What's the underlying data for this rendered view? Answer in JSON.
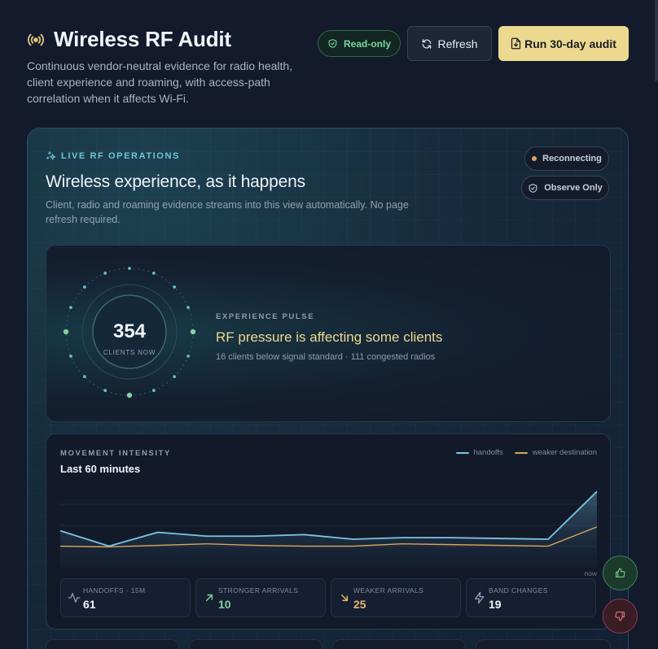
{
  "header": {
    "title": "Wireless RF Audit",
    "description": "Continuous vendor-neutral evidence for radio health, client experience and roaming, with access-path correlation when it affects Wi-Fi.",
    "readonly_label": "Read-only",
    "refresh_label": "Refresh",
    "run_label": "Run 30-day audit"
  },
  "live": {
    "eyebrow": "LIVE RF OPERATIONS",
    "title": "Wireless experience, as it happens",
    "description": "Client, radio and roaming evidence streams into this view automatically. No page refresh required.",
    "status_label": "Reconnecting",
    "mode_label": "Observe Only"
  },
  "pulse": {
    "clients_value": "354",
    "clients_label": "CLIENTS NOW",
    "kicker": "EXPERIENCE PULSE",
    "headline": "RF pressure is affecting some clients",
    "summary": "16 clients below signal standard · 111 congested radios"
  },
  "movement": {
    "kicker": "MOVEMENT INTENSITY",
    "title": "Last 60 minutes",
    "now_label": "now",
    "legend": [
      {
        "label": "handoffs",
        "color": "#7cc6e4"
      },
      {
        "label": "weaker destination",
        "color": "#d9a55f"
      }
    ],
    "stats": [
      {
        "label": "HANDOFFS · 15M",
        "value": "61",
        "icon": "activity-icon"
      },
      {
        "label": "STRONGER ARRIVALS",
        "value": "10",
        "icon": "arrow-up-right-icon"
      },
      {
        "label": "WEAKER ARRIVALS",
        "value": "25",
        "icon": "arrow-down-right-icon"
      },
      {
        "label": "BAND CHANGES",
        "value": "19",
        "icon": "lightning-icon"
      }
    ]
  },
  "chart_data": {
    "type": "area",
    "title": "Last 60 minutes",
    "series": [
      {
        "name": "handoffs",
        "values": [
          48,
          28,
          46,
          41,
          41,
          43,
          37,
          39,
          39,
          38,
          37,
          99
        ]
      },
      {
        "name": "weaker destination",
        "values": [
          28,
          27,
          29,
          31,
          29,
          28,
          28,
          31,
          30,
          29,
          28,
          53
        ]
      }
    ],
    "ylim": [
      0,
      110
    ],
    "grid": true
  },
  "feedback": {
    "up": "thumbs-up-icon",
    "down": "thumbs-down-icon"
  }
}
